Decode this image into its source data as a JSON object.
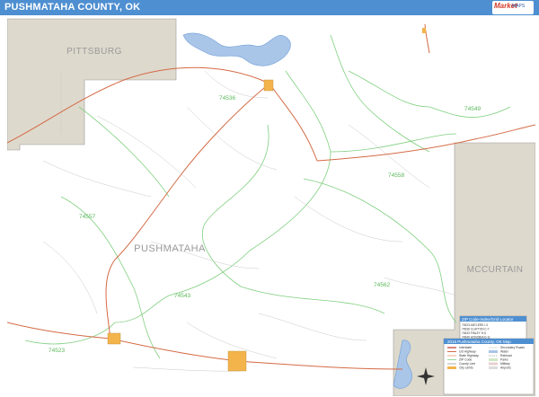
{
  "header": {
    "title": "PUSHMATAHA COUNTY, OK",
    "logo_text": "Market",
    "logo_subtext": "MAPS"
  },
  "map": {
    "county_label": "PUSHMATAHA",
    "neighbor_labels": {
      "pittsburg": "PITTSBURG",
      "mccurtain": "MCCURTAIN"
    },
    "zip_labels": {
      "z74536": "74536",
      "z74549": "74549",
      "z74558": "74558",
      "z74557": "74557",
      "z74543": "74543",
      "z74562": "74562",
      "z74523": "74523"
    },
    "colors": {
      "neighbor_fill": "#ded9cd",
      "water": "#a9c5e8",
      "water_stroke": "#6f9fd6",
      "zip_boundary": "#7fcf7f",
      "highway": "#d46a45",
      "minor_road": "#c9c9c9",
      "town": "#f4b44c",
      "header": "#4e8fd1"
    }
  },
  "zip_locator": {
    "title": "ZIP Code-Index/Grid Locator",
    "entries": [
      "74523  ANTLERS  I-3",
      "74536  CLAYTON  C-7",
      "74543  FINLEY  H-5",
      "74549  HONOBIA  D-11",
      "74557  MOYERS  F-2",
      "74558  NASHOBA  E-10",
      "74562  RATTAN  I-10"
    ]
  },
  "legend": {
    "title": "2016 Pushmataha County, OK Map",
    "items": [
      "Interstate",
      "US Highway",
      "State Highway",
      "ZIP Code",
      "County Line",
      "City Limits",
      "Secondary Roads",
      "Water",
      "Railroad",
      "Parks",
      "Military",
      "Airports"
    ]
  }
}
